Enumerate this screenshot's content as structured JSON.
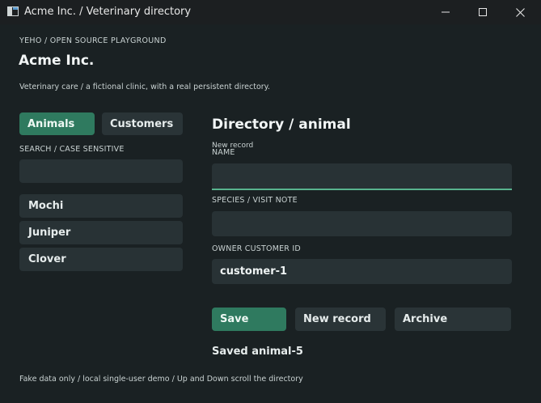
{
  "window": {
    "title": "Acme Inc. / Veterinary directory",
    "icons": {
      "app": "app-window-icon",
      "minimize": "minimize-icon",
      "maximize": "maximize-icon",
      "close": "close-icon"
    }
  },
  "header": {
    "overline": "YEHO / OPEN SOURCE PLAYGROUND",
    "brand": "Acme Inc.",
    "tagline": "Veterinary care / a fictional clinic, with a real persistent directory."
  },
  "sidebar": {
    "tabs": [
      {
        "label": "Animals",
        "active": true
      },
      {
        "label": "Customers",
        "active": false
      }
    ],
    "search_label": "SEARCH / CASE SENSITIVE",
    "search_value": "",
    "items": [
      {
        "label": "Mochi"
      },
      {
        "label": "Juniper"
      },
      {
        "label": "Clover"
      }
    ]
  },
  "editor": {
    "title": "Directory / animal",
    "record_status": "New record",
    "fields": {
      "name": {
        "label": "NAME",
        "value": ""
      },
      "species": {
        "label": "SPECIES / VISIT NOTE",
        "value": ""
      },
      "owner": {
        "label": "OWNER CUSTOMER ID",
        "value": "customer-1"
      }
    },
    "actions": {
      "save": "Save",
      "new_record": "New record",
      "archive": "Archive"
    },
    "save_status": "Saved animal-5"
  },
  "footer": {
    "text": "Fake data only / local single-user demo / Up and Down scroll the directory"
  },
  "colors": {
    "accent": "#2f7a5f",
    "focus_underline": "#58b48e",
    "surface": "#283235",
    "background": "#1a2123"
  }
}
